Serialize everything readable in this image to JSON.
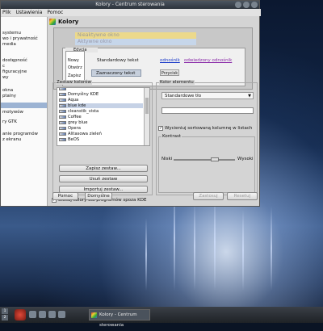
{
  "window": {
    "title": "Kolory - Centrum sterowania",
    "menu": [
      "Plik",
      "Ustawienia",
      "Pomoc"
    ]
  },
  "sidebar": {
    "items": [
      {
        "label": "systemu",
        "selected": false
      },
      {
        "label": "wo i prywatność",
        "selected": false
      },
      {
        "label": "media",
        "selected": false
      },
      {
        "label": "dostępność",
        "selected": false
      },
      {
        "label": "c",
        "selected": false
      },
      {
        "label": "figuracyjne",
        "selected": false
      },
      {
        "label": "wy",
        "selected": false
      },
      {
        "label": "okna",
        "selected": false
      },
      {
        "label": "ptalny",
        "selected": false
      },
      {
        "label": "",
        "selected": true
      },
      {
        "label": "motywów",
        "selected": false
      },
      {
        "label": "ry GTK",
        "selected": false
      },
      {
        "label": "anie programów",
        "selected": false
      },
      {
        "label": "z ekranu",
        "selected": false
      }
    ]
  },
  "header": {
    "title": "Kolory"
  },
  "preview": {
    "inactive_window": "Nieaktywne okno",
    "active_window": "Aktywne okno",
    "menu_bar": "Edycja",
    "menu_items": [
      "Nowy",
      "Otwórz",
      "Zapisz"
    ],
    "standard_text": "Standardowy tekst",
    "selected_text": "Zaznaczony tekst",
    "link": "odnośnik",
    "visited_link": "odwiedzony odnośnik",
    "button": "Przycisk"
  },
  "scheme_group": {
    "title": "Zestaw kolorów",
    "items": [
      {
        "label": "Domyślny KDE",
        "selected": false
      },
      {
        "label": "Aqua",
        "selected": false
      },
      {
        "label": "blue kde",
        "selected": true
      },
      {
        "label": "cleanstik_vista",
        "selected": false
      },
      {
        "label": "Coffee",
        "selected": false
      },
      {
        "label": "grey blue",
        "selected": false
      },
      {
        "label": "Opera",
        "selected": false
      },
      {
        "label": "Alitasowa zieleń",
        "selected": false
      },
      {
        "label": "BeOS",
        "selected": false
      }
    ],
    "save_button": "Zapisz zestaw...",
    "remove_button": "Usuń zestaw",
    "import_button": "Importuj zestaw..."
  },
  "element_group": {
    "title": "Kolor elementu",
    "selected_element": "Standardowe tło",
    "sorted_column_checkbox": "Wycieniuj sortowaną kolumnę w listach",
    "sorted_column_checked": true,
    "contrast_title": "Kontrast",
    "contrast_low": "Niski",
    "contrast_high": "Wysoki",
    "contrast_level": 0.7
  },
  "apply_outside": {
    "label": "Stosuj kolory dla programów spoza KDE",
    "checked": true
  },
  "footer": {
    "help": "Pomoc",
    "defaults": "Domyślne",
    "apply": "Zastosuj",
    "reset": "Resetuj"
  },
  "taskbar": {
    "pager": [
      "1",
      "2"
    ],
    "task": "Kolory - Centrum sterowania"
  }
}
